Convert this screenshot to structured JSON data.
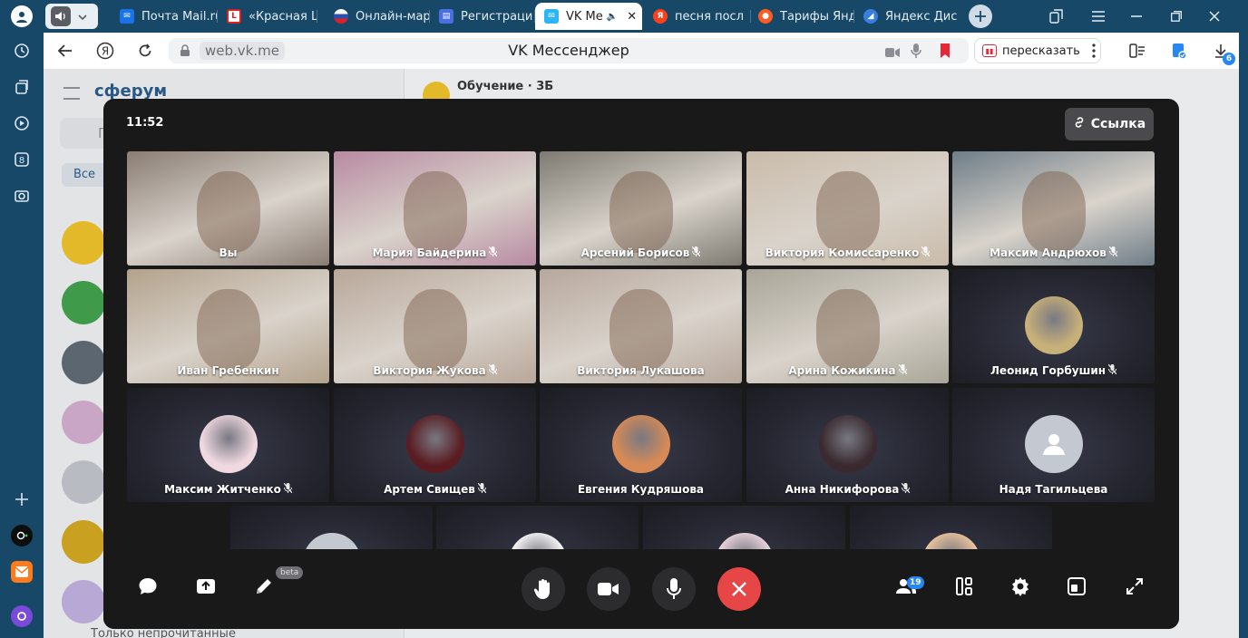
{
  "browser": {
    "tabs": [
      {
        "label": "Почта Mail.ru",
        "fav_color": "#1a73e8",
        "fav_text": "✉"
      },
      {
        "label": "«Красная Ш",
        "fav_color": "#e02020",
        "fav_text": "L"
      },
      {
        "label": "Онлайн-мар",
        "fav_color": "#2b4fb0",
        "fav_text": ""
      },
      {
        "label": "Регистраци",
        "fav_color": "#4a6fe0",
        "fav_text": "▤"
      },
      {
        "label": "VK Ме",
        "fav_color": "#2bb5f5",
        "fav_text": "✉",
        "active": true
      },
      {
        "label": "песня посл",
        "fav_color": "#fc3f1d",
        "fav_text": "Я"
      },
      {
        "label": "Тарифы Янд",
        "fav_color": "#ff5a1f",
        "fav_text": "●"
      },
      {
        "label": "Яндекс Дис",
        "fav_color": "#3a7de0",
        "fav_text": "◢"
      }
    ],
    "url": "web.vk.me",
    "page_title": "VK Мессенджер",
    "retell_label": "пересказать",
    "downloads_badge": "6"
  },
  "messenger": {
    "logo": "сферум",
    "chat_title": "Обучение · 3Б",
    "filter_all": "Все",
    "unread_only": "Только непрочитанные",
    "search_placeholder": "П"
  },
  "call": {
    "time": "11:52",
    "link_label": "Ссылка",
    "participants_count": "19",
    "beta_label": "beta",
    "participants": [
      {
        "name": "Вы",
        "muted": false,
        "type": "camera",
        "bg": "#8a7d74"
      },
      {
        "name": "Мария Байдерина",
        "muted": true,
        "type": "camera",
        "bg": "#b88aa2"
      },
      {
        "name": "Арсений Борисов",
        "muted": true,
        "type": "camera",
        "bg": "#7e7a72"
      },
      {
        "name": "Виктория Комиссаренко",
        "muted": true,
        "type": "camera",
        "bg": "#c9bba9"
      },
      {
        "name": "Максим Андрюхов",
        "muted": true,
        "type": "camera",
        "bg": "#6f7d88"
      },
      {
        "name": "Иван Гребенкин",
        "muted": false,
        "type": "camera",
        "bg": "#b3a28c"
      },
      {
        "name": "Виктория Жукова",
        "muted": true,
        "type": "camera",
        "bg": "#b9a79a"
      },
      {
        "name": "Виктория Лукашова",
        "muted": false,
        "type": "camera",
        "bg": "#b7a79c"
      },
      {
        "name": "Арина Кожикина",
        "muted": true,
        "type": "camera",
        "bg": "#a9a598"
      },
      {
        "name": "Леонид Горбушин",
        "muted": true,
        "type": "avatar",
        "av": "#c8b079"
      },
      {
        "name": "Максим Житченко",
        "muted": true,
        "type": "avatar",
        "av": "#f0d8e0"
      },
      {
        "name": "Артем Свищев",
        "muted": true,
        "type": "avatar",
        "av": "#5a1c22"
      },
      {
        "name": "Евгения Кудряшова",
        "muted": false,
        "type": "avatar",
        "av": "#d78a56"
      },
      {
        "name": "Анна Никифорова",
        "muted": true,
        "type": "avatar",
        "av": "#3a2a30"
      },
      {
        "name": "Надя Тагильцева",
        "muted": false,
        "type": "placeholder",
        "av": "#c4c8d0"
      },
      {
        "name": "",
        "muted": false,
        "type": "placeholder",
        "av": "#c4c8d0"
      },
      {
        "name": "",
        "muted": false,
        "type": "avatar",
        "av": "#ffffff"
      },
      {
        "name": "",
        "muted": false,
        "type": "avatar",
        "av": "#f0d8e0"
      },
      {
        "name": "",
        "muted": false,
        "type": "avatar",
        "av": "#f2c7a0"
      }
    ]
  },
  "colors": {
    "accent": "#2787f5",
    "end_call": "#e64646",
    "call_bg": "#19191a"
  }
}
